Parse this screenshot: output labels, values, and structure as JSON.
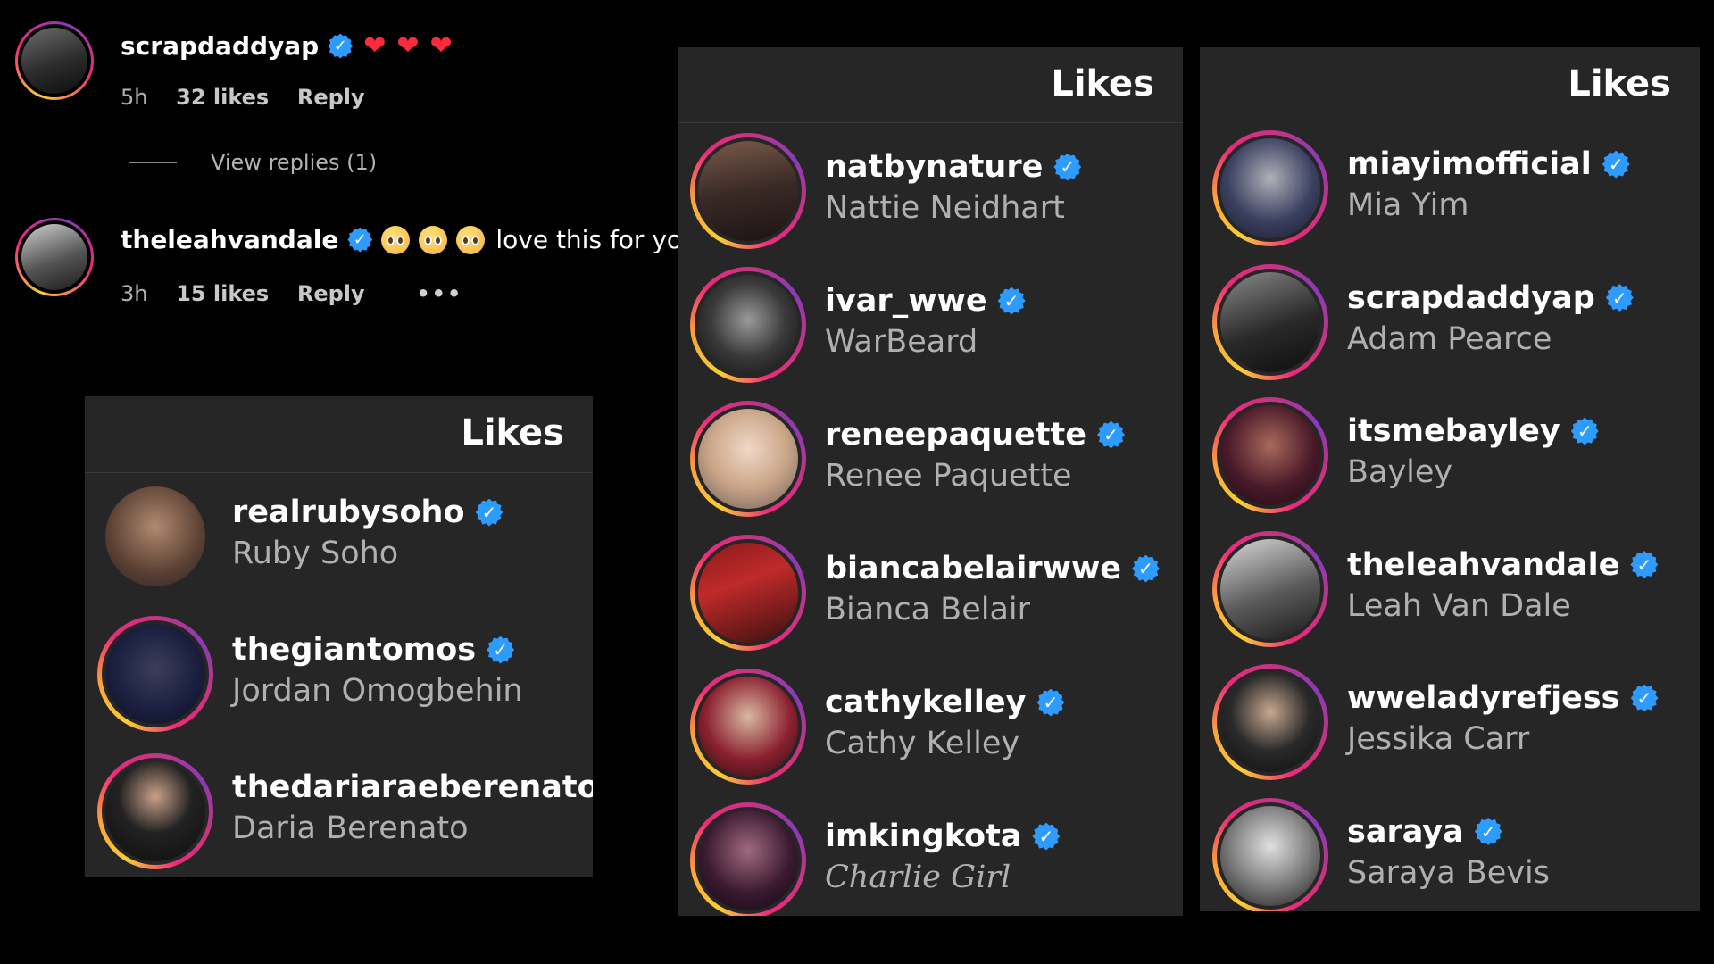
{
  "colors": {
    "badge": "#2e9bff",
    "panel_bg": "#262626",
    "page_bg": "#000000",
    "heart": "#ff2b3d"
  },
  "comments": [
    {
      "username": "scrapdaddyap",
      "text": "",
      "emoji": [
        "heart",
        "heart",
        "heart"
      ],
      "time": "5h",
      "likes": "32 likes",
      "reply": "Reply",
      "photo": "linear-gradient(160deg,#6d6d6d,#2c2c2c 55%,#0d0d0d)"
    },
    {
      "username": "theleahvandale",
      "text": "love this for you",
      "emoji": [
        "pleading-face",
        "pleading-face",
        "pleading-face"
      ],
      "time": "3h",
      "likes": "15 likes",
      "reply": "Reply",
      "more": "•••",
      "photo": "linear-gradient(160deg,#cfcfcf,#555 55%,#1a1a1a)"
    }
  ],
  "view_replies": "View replies (1)",
  "panels": [
    {
      "title": "Likes",
      "items": [
        {
          "username": "realrubysoho",
          "name": "Ruby Soho",
          "ring": false,
          "photo": "radial-gradient(circle at 50% 40%,#b08a70,#5a4033 60%,#2a2420)"
        },
        {
          "username": "thegiantomos",
          "name": "Jordan Omogbehin",
          "ring": true,
          "photo": "radial-gradient(circle at 50% 45%,#3b3f5a,#1c2040 55%,#0a0c1a)"
        },
        {
          "username": "thedariaraeberenato",
          "name": "Daria Berenato",
          "ring": true,
          "photo": "radial-gradient(circle at 50% 35%,#c9a08a,#222 45%,#0d0d0d)"
        }
      ]
    },
    {
      "title": "Likes",
      "items": [
        {
          "username": "natbynature",
          "name": "Nattie Neidhart",
          "ring": true,
          "photo": "linear-gradient(170deg,#7a5a4a,#3a2a26 50%,#1a1414)"
        },
        {
          "username": "ivar_wwe",
          "name": "WarBeard",
          "ring": true,
          "photo": "radial-gradient(circle at 50% 45%,#9a9a9a,#3a3a3a 50%,#0d0d0d)"
        },
        {
          "username": "reneepaquette",
          "name": "Renee Paquette",
          "ring": true,
          "photo": "radial-gradient(circle at 50% 40%,#f0d8c8,#caa688 50%,#6a5a5a)"
        },
        {
          "username": "biancabelairwwe",
          "name": "Bianca Belair",
          "ring": true,
          "photo": "linear-gradient(160deg,#8a1a1a,#c02a2a 40%,#3a1010)"
        },
        {
          "username": "cathykelley",
          "name": "Cathy Kelley",
          "ring": true,
          "photo": "radial-gradient(circle at 50% 40%,#d9b8a0,#8a2030 55%,#201010)"
        },
        {
          "username": "imkingkota",
          "name": "Charlie Girl",
          "ring": true,
          "gothic": true,
          "photo": "radial-gradient(circle at 50% 40%,#a06a80,#3a1a30 55%,#0d0810)"
        }
      ]
    },
    {
      "title": "Likes",
      "items": [
        {
          "username": "miayimofficial",
          "name": "Mia Yim",
          "ring": true,
          "photo": "radial-gradient(circle at 50% 40%,#b0b0b8,#3a4060 55%,#1a1a28)"
        },
        {
          "username": "scrapdaddyap",
          "name": "Adam Pearce",
          "ring": true,
          "photo": "linear-gradient(160deg,#8a8a8a,#2a2a2a 55%,#0d0d0d)"
        },
        {
          "username": "itsmebayley",
          "name": "Bayley",
          "ring": true,
          "photo": "radial-gradient(circle at 50% 40%,#a86a5a,#4a1a2a 55%,#1a0a10)"
        },
        {
          "username": "theleahvandale",
          "name": "Leah Van Dale",
          "ring": true,
          "photo": "linear-gradient(160deg,#d8d8d8,#5a5a5a 55%,#1a1a1a)"
        },
        {
          "username": "wweladyrefjess",
          "name": "Jessika Carr",
          "ring": true,
          "photo": "radial-gradient(circle at 50% 40%,#c8a890,#2a2a2a 50%,#0d0d0d)"
        },
        {
          "username": "saraya",
          "name": "Saraya Bevis",
          "ring": true,
          "photo": "radial-gradient(circle at 50% 40%,#e0e0e0,#8a8a8a 45%,#1a1a1a)"
        }
      ]
    }
  ]
}
